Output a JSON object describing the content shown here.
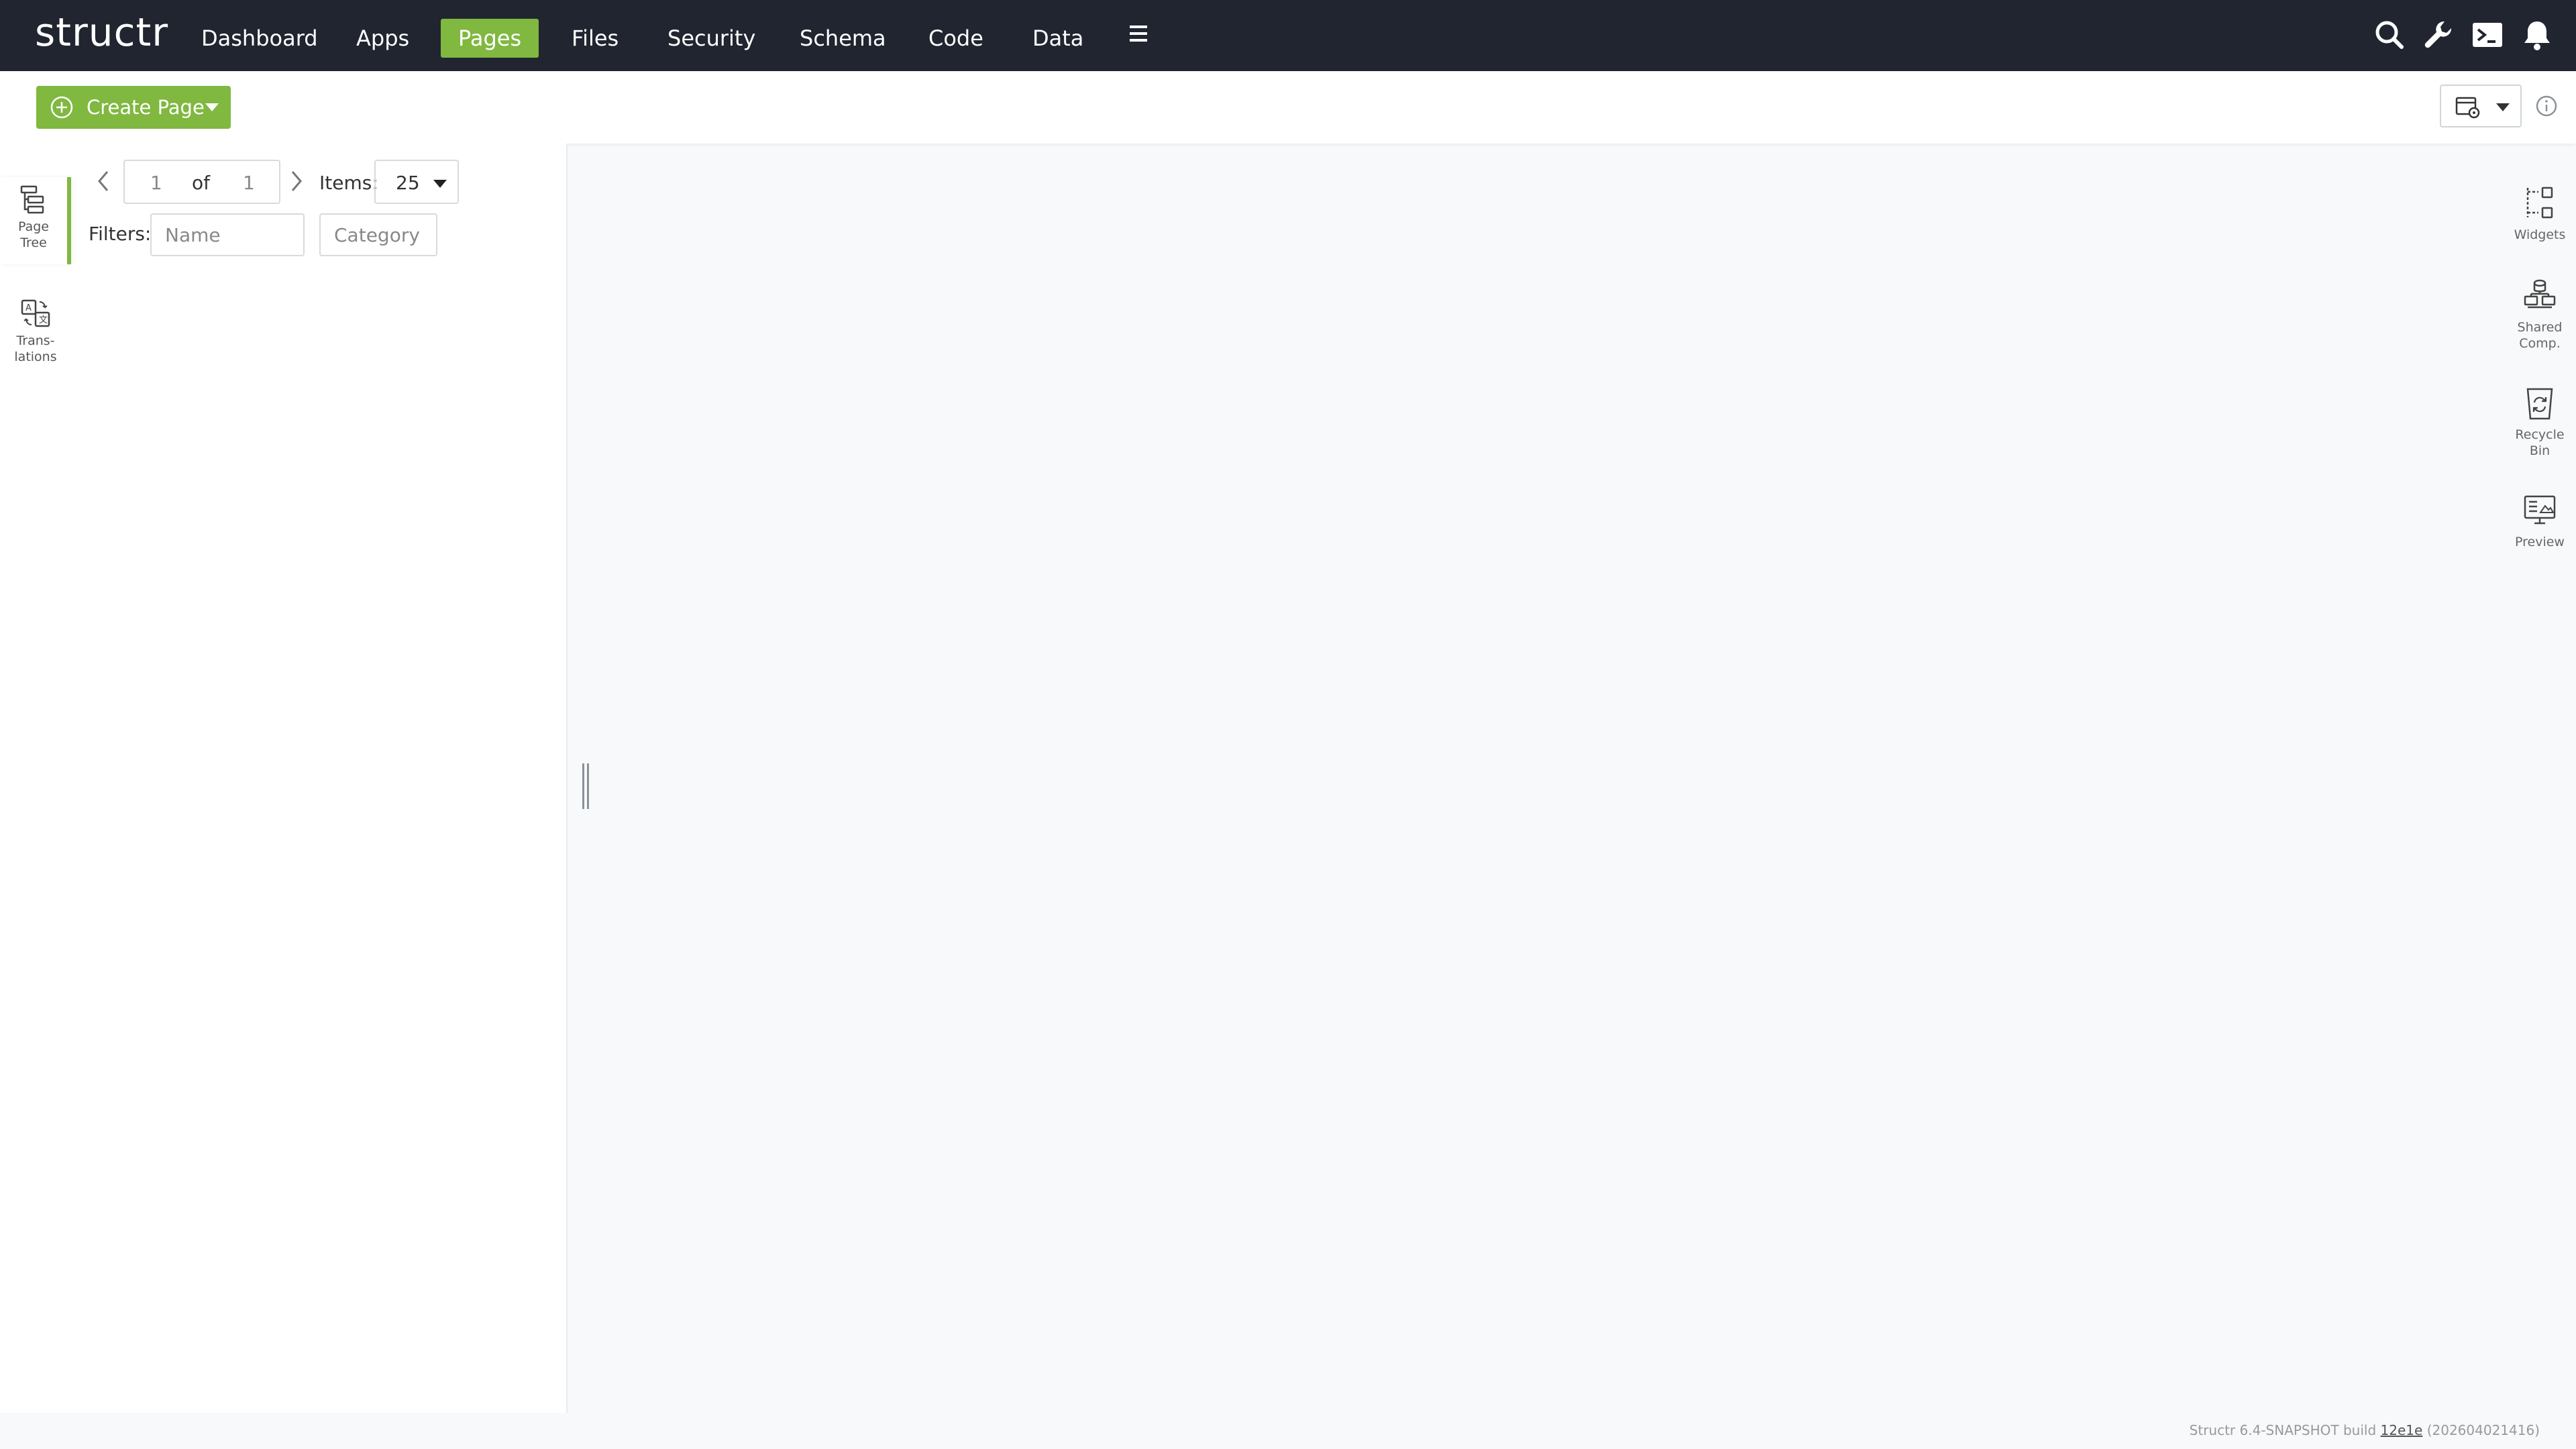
{
  "app": {
    "logo": "structr"
  },
  "nav": {
    "items": [
      {
        "label": "Dashboard",
        "active": false
      },
      {
        "label": "Apps",
        "active": false
      },
      {
        "label": "Pages",
        "active": true
      },
      {
        "label": "Files",
        "active": false
      },
      {
        "label": "Security",
        "active": false
      },
      {
        "label": "Schema",
        "active": false
      },
      {
        "label": "Code",
        "active": false
      },
      {
        "label": "Data",
        "active": false
      }
    ],
    "menu_icon": "hamburger-icon",
    "right_icons": [
      "search-icon",
      "wrench-icon",
      "terminal-icon",
      "bell-icon"
    ]
  },
  "toolbar": {
    "create_page_label": "Create Page",
    "view_selector_icon": "page-settings-icon"
  },
  "left_sidebar": {
    "tabs": [
      {
        "line1": "Page",
        "line2": "Tree",
        "icon": "page-tree-icon",
        "active": true
      },
      {
        "line1": "Trans-",
        "line2": "lations",
        "icon": "translations-icon",
        "active": false
      }
    ]
  },
  "pager": {
    "current_page": "1",
    "of_label": "of",
    "total_pages": "1",
    "items_label": "Items:",
    "items_per_page": "25"
  },
  "filters": {
    "label": "Filters:",
    "name_placeholder": "Name",
    "category_placeholder": "Category"
  },
  "right_sidebar": {
    "tabs": [
      {
        "line1": "Widgets",
        "line2": "",
        "icon": "widgets-icon"
      },
      {
        "line1": "Shared",
        "line2": "Comp.",
        "icon": "shared-components-icon"
      },
      {
        "line1": "Recycle",
        "line2": "Bin",
        "icon": "recycle-bin-icon"
      },
      {
        "line1": "Preview",
        "line2": "",
        "icon": "preview-icon"
      }
    ]
  },
  "footer": {
    "prefix": "Structr 6.4-SNAPSHOT build",
    "build": "12e1e",
    "date": "(202604021416)"
  },
  "colors": {
    "topbar": "#202530",
    "accent": "#80b840",
    "background": "#f7f9fa"
  }
}
